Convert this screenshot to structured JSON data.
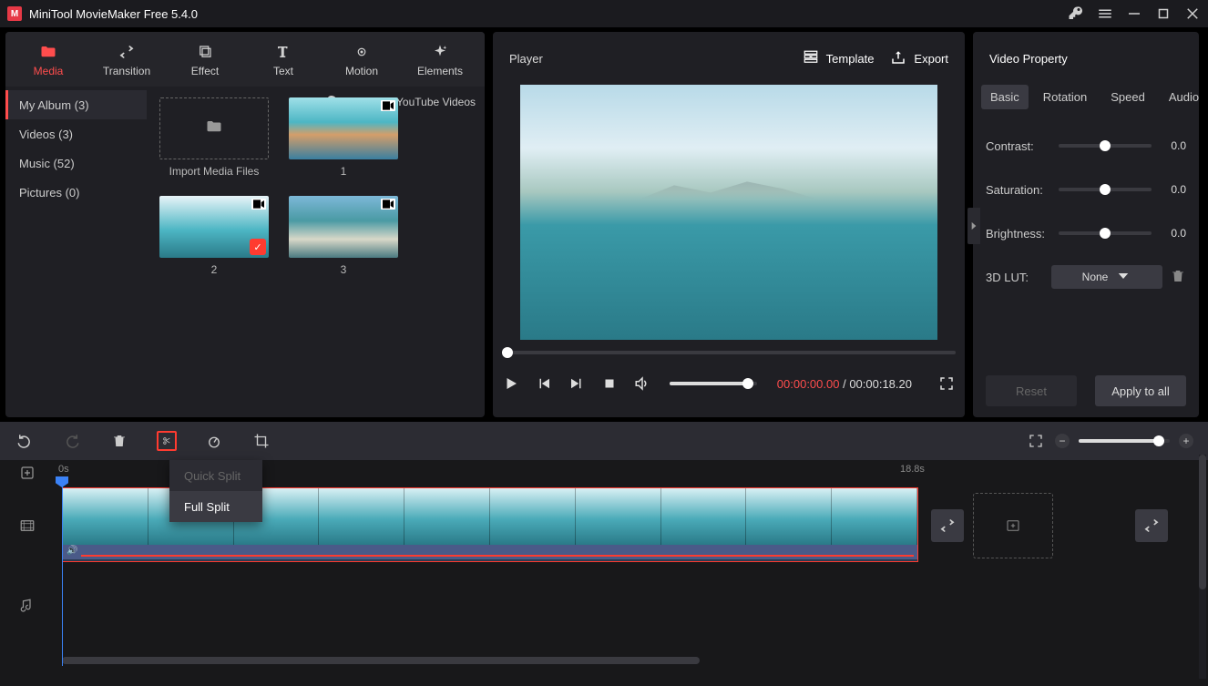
{
  "titlebar": {
    "title": "MiniTool MovieMaker Free 5.4.0"
  },
  "toolbar": {
    "items": [
      {
        "label": "Media",
        "icon": "folder"
      },
      {
        "label": "Transition",
        "icon": "swap"
      },
      {
        "label": "Effect",
        "icon": "layers"
      },
      {
        "label": "Text",
        "icon": "text"
      },
      {
        "label": "Motion",
        "icon": "motion"
      },
      {
        "label": "Elements",
        "icon": "sparkle"
      }
    ]
  },
  "sidebar": {
    "items": [
      {
        "label": "My Album (3)"
      },
      {
        "label": "Videos (3)"
      },
      {
        "label": "Music (52)"
      },
      {
        "label": "Pictures (0)"
      }
    ],
    "download_link": "Download YouTube Videos"
  },
  "media": {
    "import_label": "Import Media Files",
    "thumbs": [
      {
        "label": "1"
      },
      {
        "label": "2",
        "checked": true
      },
      {
        "label": "3"
      }
    ]
  },
  "player": {
    "title": "Player",
    "template_label": "Template",
    "export_label": "Export",
    "time_current": "00:00:00.00",
    "time_sep": " / ",
    "time_total": "00:00:18.20"
  },
  "property": {
    "title": "Video Property",
    "tabs": [
      "Basic",
      "Rotation",
      "Speed",
      "Audio"
    ],
    "rows": [
      {
        "label": "Contrast:",
        "value": "0.0"
      },
      {
        "label": "Saturation:",
        "value": "0.0"
      },
      {
        "label": "Brightness:",
        "value": "0.0"
      }
    ],
    "lut_label": "3D LUT:",
    "lut_value": "None",
    "reset_label": "Reset",
    "apply_label": "Apply to all"
  },
  "timeline": {
    "ruler": {
      "start": "0s",
      "end": "18.8s"
    },
    "split_menu": {
      "quick": "Quick Split",
      "full": "Full Split"
    }
  }
}
